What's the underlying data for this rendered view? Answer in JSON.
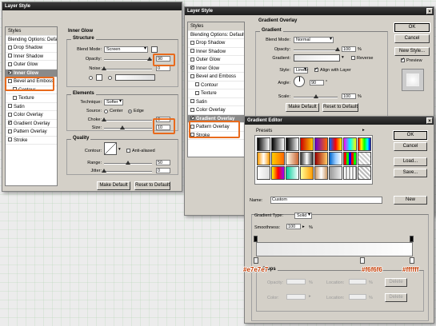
{
  "win1": {
    "title": "Layer Style",
    "styles_header": "Styles",
    "blending": "Blending Options: Default",
    "items": [
      {
        "label": "Drop Shadow",
        "checked": false
      },
      {
        "label": "Inner Shadow",
        "checked": false
      },
      {
        "label": "Outer Glow",
        "checked": false
      },
      {
        "label": "Inner Glow",
        "checked": true
      },
      {
        "label": "Bevel and Emboss",
        "checked": false
      },
      {
        "label": "Contour",
        "checked": false
      },
      {
        "label": "Texture",
        "checked": false
      },
      {
        "label": "Satin",
        "checked": false
      },
      {
        "label": "Color Overlay",
        "checked": false
      },
      {
        "label": "Gradient Overlay",
        "checked": true
      },
      {
        "label": "Pattern Overlay",
        "checked": false
      },
      {
        "label": "Stroke",
        "checked": false
      }
    ],
    "panel_title": "Inner Glow",
    "structure_title": "Structure",
    "blend_mode_label": "Blend Mode:",
    "blend_mode_value": "Screen",
    "opacity_label": "Opacity:",
    "opacity_value": "90",
    "noise_label": "Noise:",
    "noise_value": "0",
    "elements_title": "Elements",
    "technique_label": "Technique:",
    "technique_value": "Softer",
    "source_label": "Source:",
    "source_center": "Center",
    "source_edge": "Edge",
    "choke_label": "Choke:",
    "choke_value": "0",
    "size_label": "Size:",
    "size_value": "10",
    "quality_title": "Quality",
    "contour_label": "Contour:",
    "antialiased_label": "Anti-aliased",
    "range_label": "Range:",
    "range_value": "50",
    "jitter_label": "Jitter:",
    "jitter_value": "0",
    "make_default": "Make Default",
    "reset_default": "Reset to Default"
  },
  "win2": {
    "title": "Layer Style",
    "styles_header": "Styles",
    "blending": "Blending Options: Default",
    "items": [
      {
        "label": "Drop Shadow",
        "checked": false
      },
      {
        "label": "Inner Shadow",
        "checked": false
      },
      {
        "label": "Outer Glow",
        "checked": false
      },
      {
        "label": "Inner Glow",
        "checked": true
      },
      {
        "label": "Bevel and Emboss",
        "checked": false
      },
      {
        "label": "Contour",
        "checked": false
      },
      {
        "label": "Texture",
        "checked": false
      },
      {
        "label": "Satin",
        "checked": false
      },
      {
        "label": "Color Overlay",
        "checked": false
      },
      {
        "label": "Gradient Overlay",
        "checked": true
      },
      {
        "label": "Pattern Overlay",
        "checked": false
      },
      {
        "label": "Stroke",
        "checked": false
      }
    ],
    "panel_title": "Gradient Overlay",
    "gradient_title": "Gradient",
    "blend_mode_label": "Blend Mode:",
    "blend_mode_value": "Normal",
    "opacity_label": "Opacity:",
    "opacity_value": "100",
    "gradient_label": "Gradient:",
    "reverse_label": "Reverse",
    "style_label": "Style:",
    "style_value": "Linear",
    "align_label": "Align with Layer",
    "angle_label": "Angle:",
    "angle_value": "90",
    "scale_label": "Scale:",
    "scale_value": "100",
    "make_default": "Make Default",
    "reset_default": "Reset to Default",
    "ok": "OK",
    "cancel": "Cancel",
    "new_style": "New Style...",
    "preview": "Preview"
  },
  "editor": {
    "title": "Gradient Editor",
    "presets_label": "Presets",
    "ok": "OK",
    "cancel": "Cancel",
    "load": "Load...",
    "save": "Save...",
    "name_label": "Name:",
    "name_value": "Custom",
    "new_button": "New",
    "type_label": "Gradient Type:",
    "type_value": "Solid",
    "smoothness_label": "Smoothness:",
    "smoothness_value": "100",
    "stops_title": "Stops",
    "opacity_label": "Opacity:",
    "location_label": "Location:",
    "color_label": "Color:",
    "delete_label": "Delete",
    "percent": "%"
  },
  "annotations": {
    "c1": "#e7e7e7",
    "c2": "#f6f6f6",
    "c3": "#ffffff"
  },
  "colors": {
    "highlight": "#e86a1c",
    "stop_left": "#e7e7e7",
    "stop_mid": "#f6f6f6",
    "stop_right": "#ffffff"
  }
}
